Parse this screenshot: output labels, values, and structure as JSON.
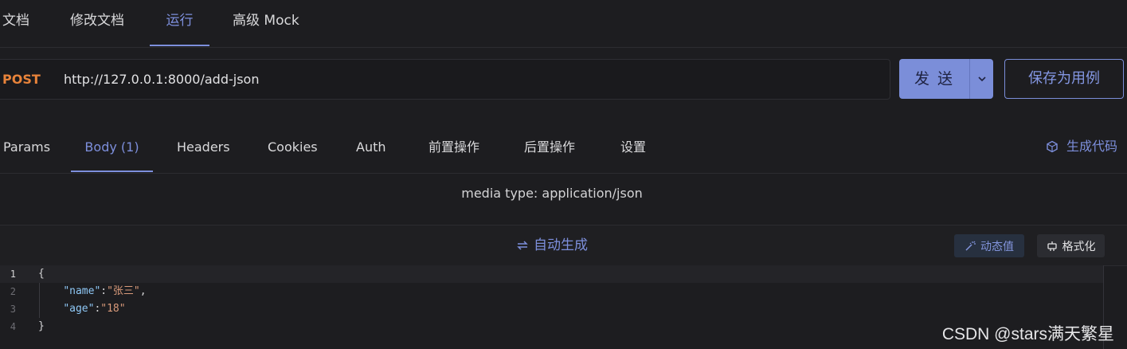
{
  "top_tabs": [
    {
      "label": "文档",
      "active": false
    },
    {
      "label": "修改文档",
      "active": false
    },
    {
      "label": "运行",
      "active": true
    },
    {
      "label": "高级 Mock",
      "active": false
    }
  ],
  "request": {
    "method": "POST",
    "url": "http://127.0.0.1:8000/add-json",
    "send_label": "发 送",
    "save_label": "保存为用例"
  },
  "req_tabs": [
    {
      "label": "Params",
      "active": false
    },
    {
      "label": "Body (1)",
      "active": true
    },
    {
      "label": "Headers",
      "active": false
    },
    {
      "label": "Cookies",
      "active": false
    },
    {
      "label": "Auth",
      "active": false
    },
    {
      "label": "前置操作",
      "active": false
    },
    {
      "label": "后置操作",
      "active": false
    },
    {
      "label": "设置",
      "active": false
    }
  ],
  "gen_code_label": "生成代码",
  "body": {
    "media_type": "media type: application/json",
    "autogen_label": "自动生成",
    "dynamic_value_label": "动态值",
    "format_label": "格式化"
  },
  "code": {
    "line_numbers": [
      "1",
      "2",
      "3",
      "4"
    ],
    "open_brace": "{",
    "close_brace": "}",
    "fields": [
      {
        "key": "\"name\"",
        "value": "\"张三\"",
        "trailing": ","
      },
      {
        "key": "\"age\"",
        "value": "\"18\"",
        "trailing": ""
      }
    ]
  },
  "watermark": "CSDN @stars满天繁星",
  "colors": {
    "accent": "#7d8fdc",
    "method_post": "#e8833a",
    "background": "#1d1d20"
  }
}
